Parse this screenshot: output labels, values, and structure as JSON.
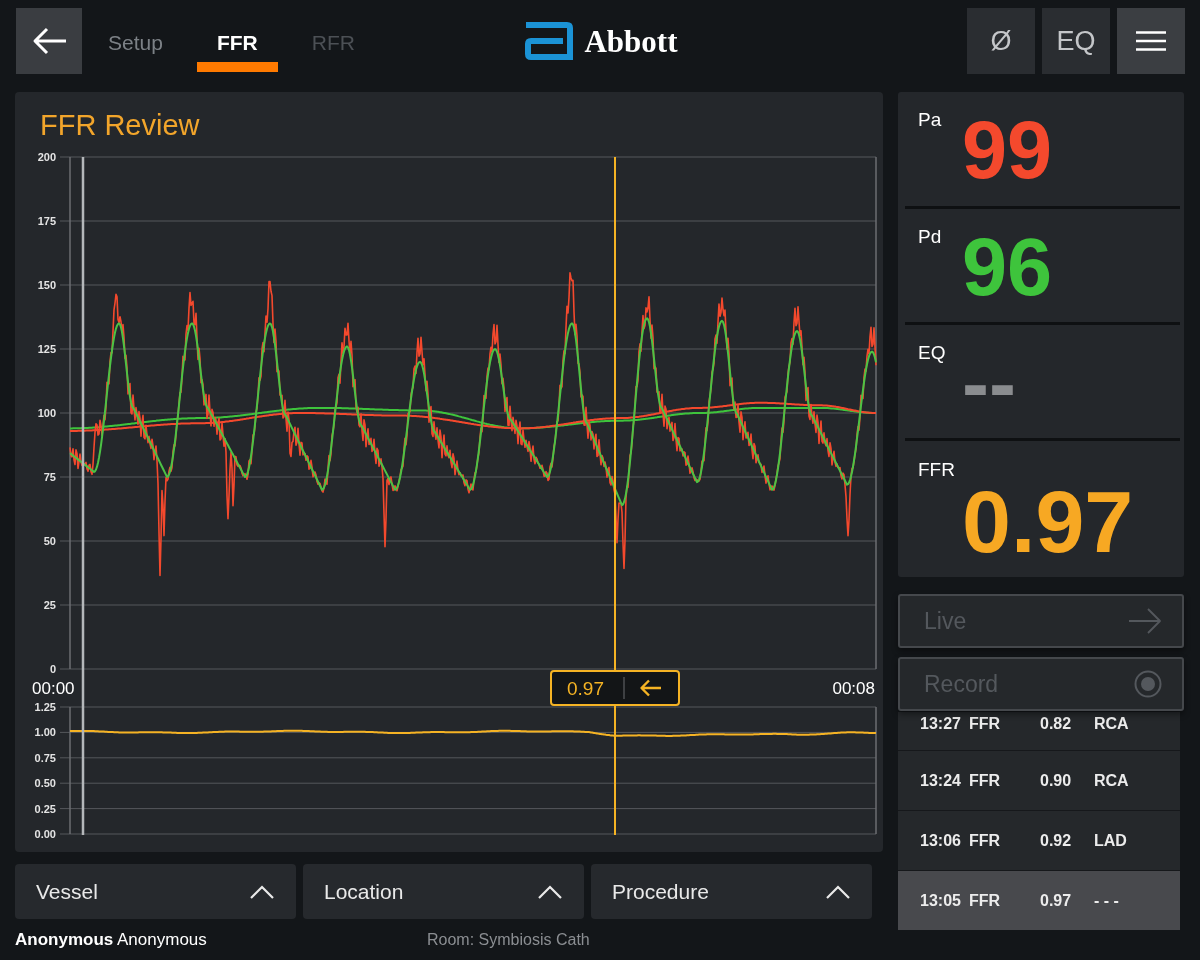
{
  "top_bar": {
    "tabs": [
      {
        "label": "Setup",
        "selected": false,
        "disabled": false
      },
      {
        "label": "FFR",
        "selected": true,
        "disabled": false
      },
      {
        "label": "RFR",
        "selected": false,
        "disabled": true
      }
    ],
    "logo": {
      "text": "Abbott"
    },
    "buttons": [
      {
        "kind": "text",
        "label": "Ø"
      },
      {
        "kind": "text",
        "label": "EQ"
      },
      {
        "kind": "menu"
      }
    ]
  },
  "review_panel": {
    "title": "FFR Review",
    "pressure_chart": {
      "y_ticks": [
        "200",
        "175",
        "150",
        "125",
        "100",
        "75",
        "50",
        "25",
        "0"
      ],
      "x_labels": [
        "00:00",
        "00:08"
      ]
    },
    "cursor_tag": {
      "value": "0.97"
    },
    "ffr_chart": {
      "y_ticks": [
        "1.25",
        "1.00",
        "0.75",
        "0.50",
        "0.25",
        "0.00"
      ]
    }
  },
  "selectors": [
    {
      "label": "Vessel"
    },
    {
      "label": "Location"
    },
    {
      "label": "Procedure"
    }
  ],
  "footer": {
    "patient": "**Anonymous** Anonymous",
    "room": "Room: Symbiosis Cath"
  },
  "readings": [
    {
      "kind": "inline",
      "label": "Pa",
      "value": "99",
      "color": "#f4492d"
    },
    {
      "kind": "inline",
      "label": "Pd",
      "value": "96",
      "color": "#3ec43c"
    },
    {
      "kind": "inline",
      "label": "EQ",
      "value": "--",
      "color": "#8a8c8f"
    },
    {
      "kind": "large",
      "label": "FFR",
      "value": "0.97",
      "color": "#f7a823"
    }
  ],
  "side_buttons": [
    {
      "kind": "live",
      "label": "Live",
      "disabled": true
    },
    {
      "kind": "record",
      "label": "Record",
      "disabled": true
    }
  ],
  "measurements": [
    {
      "time": "13:27",
      "type": "FFR",
      "value": "0.82",
      "vessel": "RCA",
      "selected": false
    },
    {
      "time": "13:24",
      "type": "FFR",
      "value": "0.90",
      "vessel": "RCA",
      "selected": false
    },
    {
      "time": "13:06",
      "type": "FFR",
      "value": "0.92",
      "vessel": "LAD",
      "selected": false
    },
    {
      "time": "13:05",
      "type": "FFR",
      "value": "0.97",
      "vessel": "- - -",
      "selected": true
    }
  ]
}
